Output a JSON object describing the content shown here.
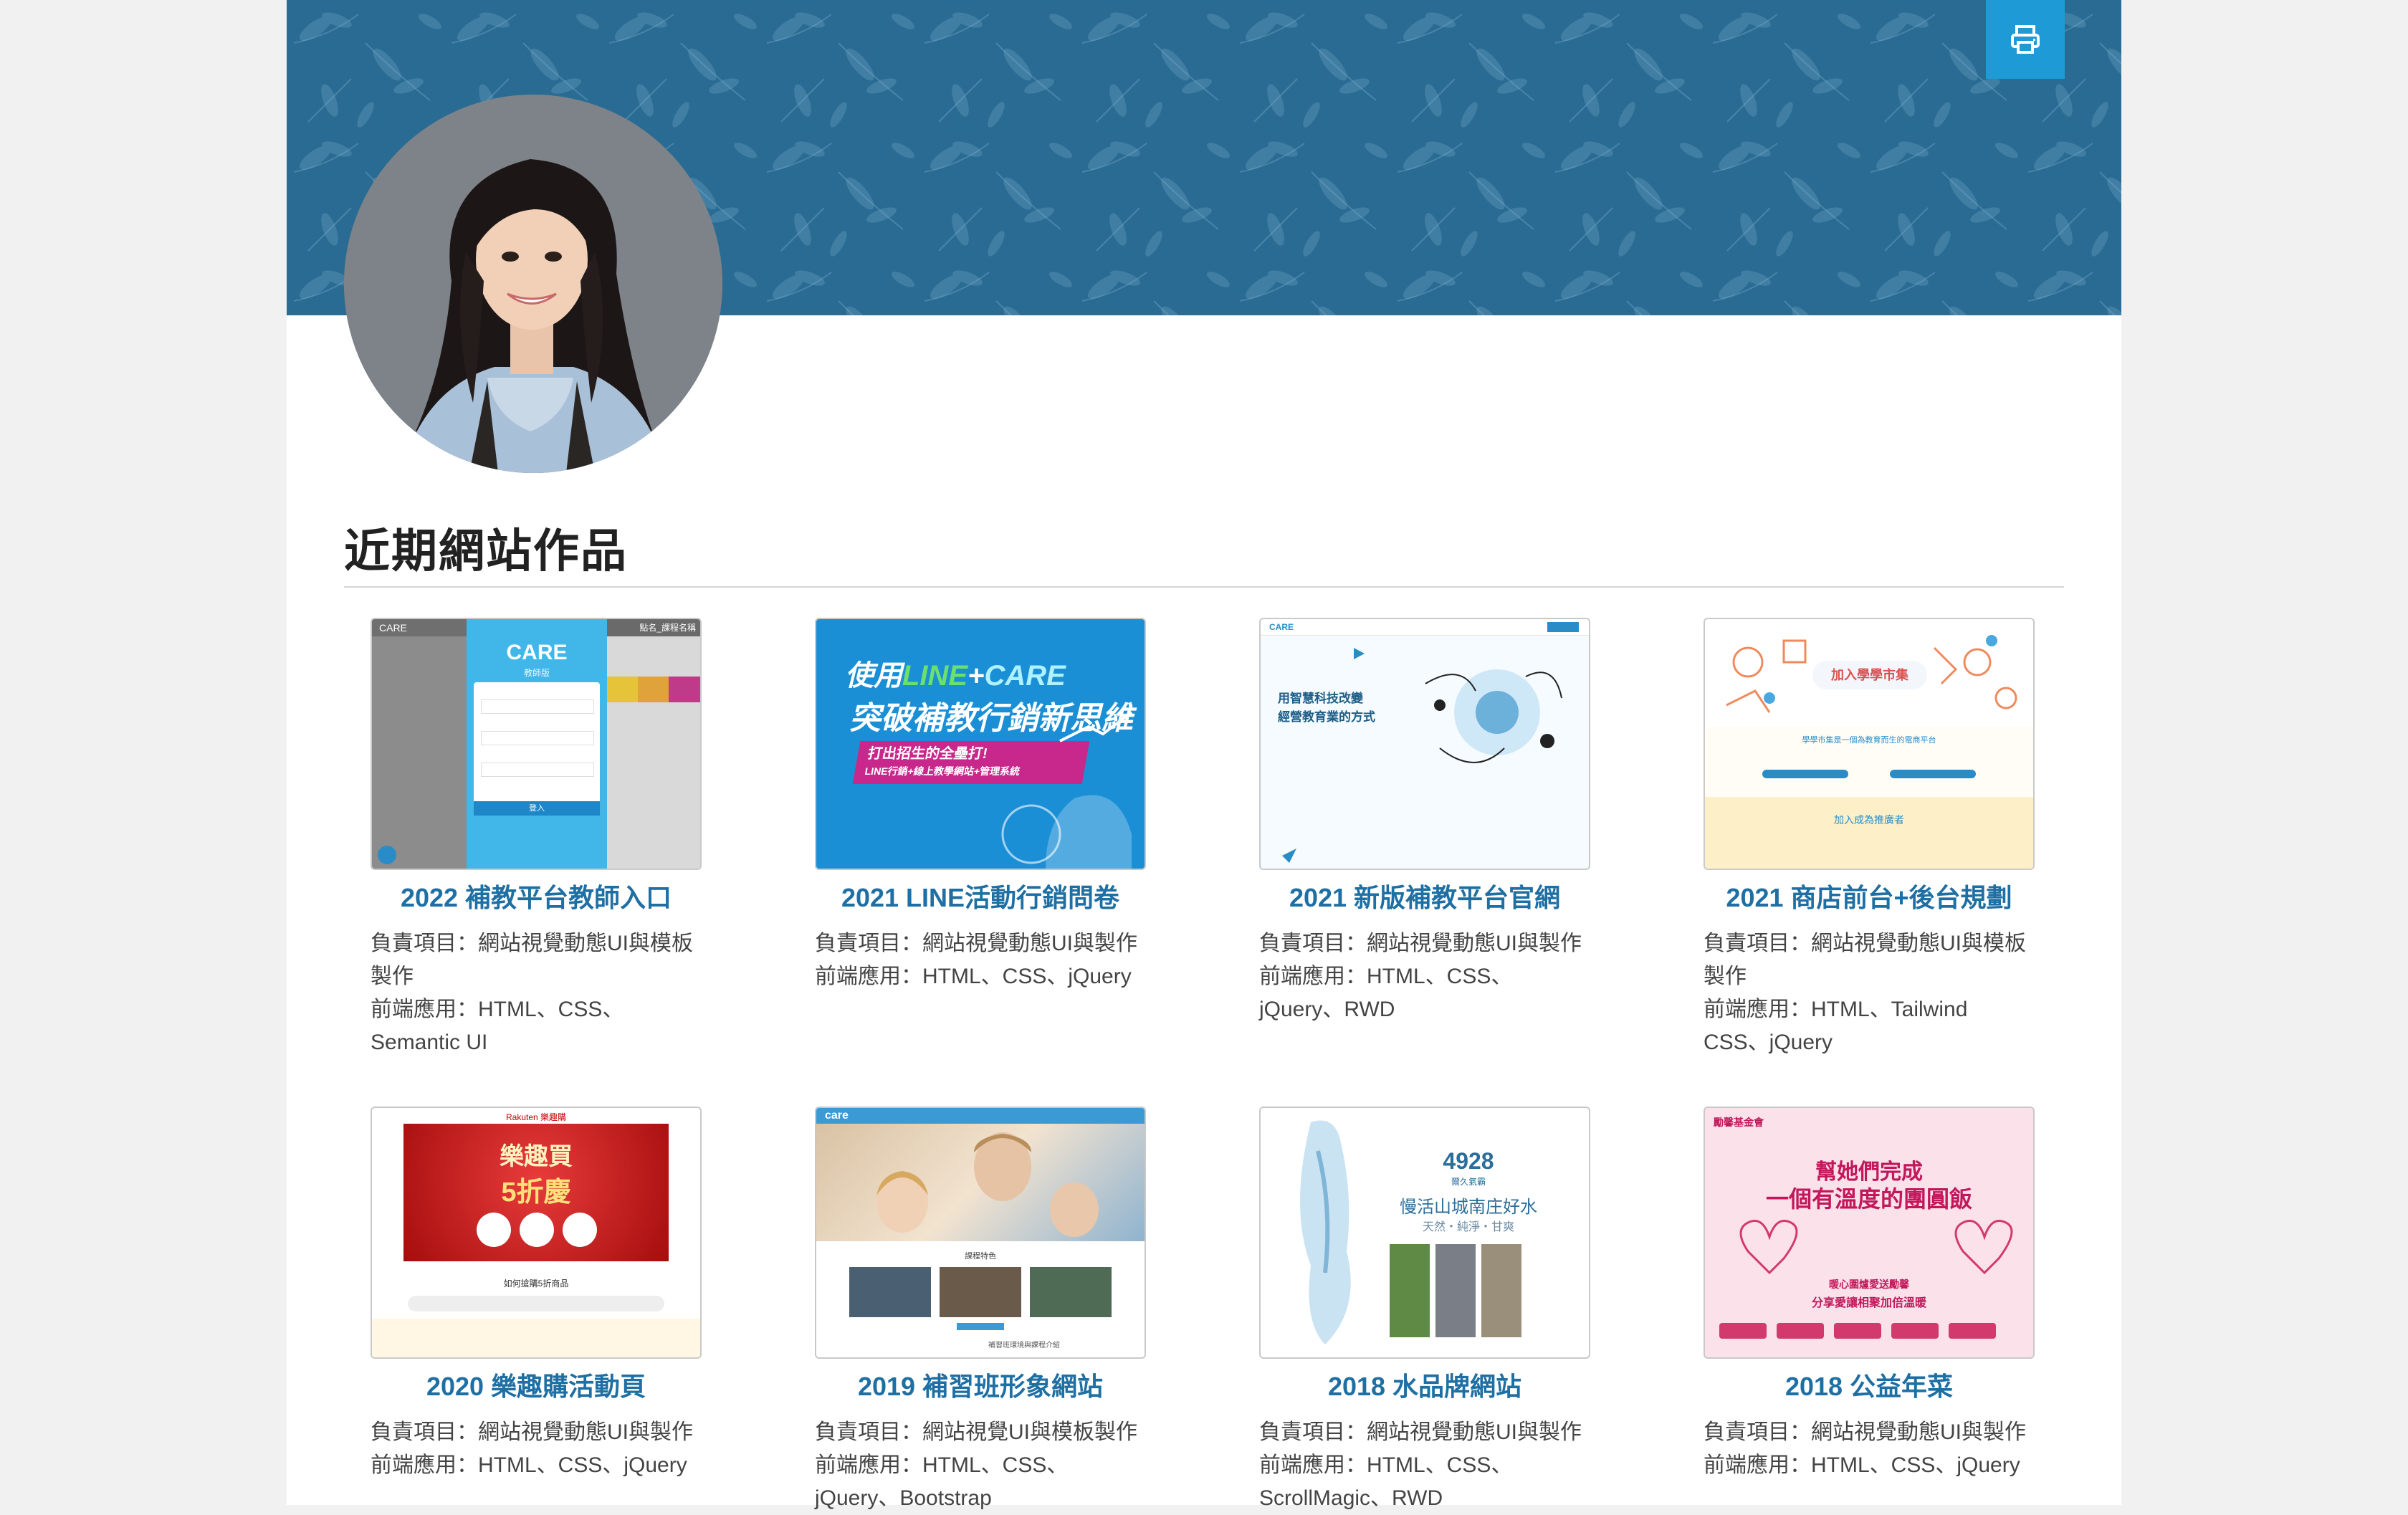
{
  "header": {
    "print_icon": "printer-icon",
    "banner_color": "#2a6b94",
    "accent_color": "#1e9ad6"
  },
  "section": {
    "title": "近期網站作品"
  },
  "works": [
    {
      "title": "2022 補教平台教師入口",
      "role": "負責項目：網站視覺動態UI與模板製作",
      "tech_line1": "前端應用：HTML、CSS、",
      "tech_line2": "Semantic UI",
      "thumb": {
        "heading": "CARE",
        "sub": "教師版",
        "button": "登入",
        "top": "CARE",
        "right": "點名_課程名稱"
      }
    },
    {
      "title": "2021 LINE活動行銷問卷",
      "role": "負責項目：網站視覺動態UI與製作",
      "tech_line1": "前端應用：HTML、CSS、jQuery",
      "tech_line2": "",
      "thumb": {
        "line1a": "使用",
        "line1b": "LINE",
        "line1c": "+",
        "line1d": "CARE",
        "line2": "突破補教行銷新思維",
        "ribbon1": "打出招生的全壘打!",
        "ribbon2": "LINE行銷+線上教學網站+管理系統"
      }
    },
    {
      "title": "2021 新版補教平台官網",
      "role": "負責項目：網站視覺動態UI與製作",
      "tech_line1": "前端應用：HTML、CSS、",
      "tech_line2": "jQuery、RWD",
      "thumb": {
        "logo": "CARE",
        "line1": "用智慧科技改變",
        "line2": "經營教育業的方式"
      }
    },
    {
      "title": "2021 商店前台+後台規劃",
      "role": "負責項目：網站視覺動態UI與模板製作",
      "tech_line1": "前端應用：HTML、Tailwind",
      "tech_line2": "CSS、jQuery",
      "thumb": {
        "badge": "加入學學市集",
        "sub": "學學市集是一個為教育而生的電商平台",
        "join": "加入成為推廣者"
      }
    },
    {
      "title": "2020 樂趣購活動頁",
      "role": "負責項目：網站視覺動態UI與製作",
      "tech_line1": "前端應用：HTML、CSS、jQuery",
      "tech_line2": "",
      "thumb": {
        "brand": "Rakuten 樂趣購",
        "line1": "樂趣買",
        "line2": "5折慶",
        "sub": "如何搶購5折商品"
      }
    },
    {
      "title": "2019 補習班形象網站",
      "role": "負責項目：網站視覺UI與模板製作",
      "tech_line1": "前端應用：HTML、CSS、",
      "tech_line2": "jQuery、Bootstrap",
      "thumb": {
        "logo": "care",
        "caption": "課程特色",
        "bottom": "補習班環境與課程介紹"
      }
    },
    {
      "title": "2018 水品牌網站",
      "role": "負責項目：網站視覺動態UI與製作",
      "tech_line1": "前端應用：HTML、CSS、",
      "tech_line2": "ScrollMagic、RWD",
      "thumb": {
        "number": "4928",
        "brand": "爾久氣霸",
        "line1": "慢活山城南庄好水",
        "line2": "天然・純淨・甘爽"
      }
    },
    {
      "title": "2018 公益年菜",
      "role": "負責項目：網站視覺動態UI與製作",
      "tech_line1": "前端應用：HTML、CSS、jQuery",
      "tech_line2": "",
      "thumb": {
        "org": "勵馨基金會",
        "line1": "幫她們完成",
        "line2": "一個有溫度的團圓飯",
        "line3": "暖心圍爐愛送勵馨",
        "line4": "分享愛讓相聚加倍溫暖"
      }
    }
  ]
}
